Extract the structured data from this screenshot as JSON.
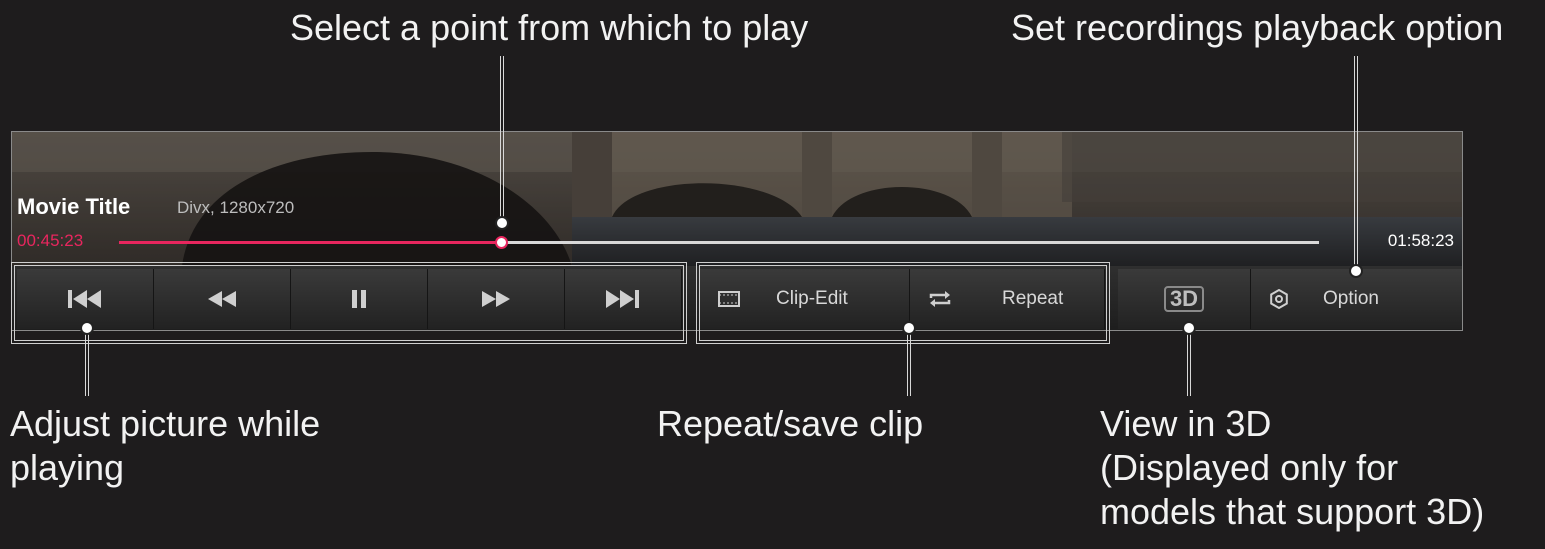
{
  "callouts": {
    "seek": "Select a point from which to play",
    "option": "Set recordings playback option",
    "adjust_line1": "Adjust picture while",
    "adjust_line2": "playing",
    "repeat_save": "Repeat/save clip",
    "view3d_line1": "View in 3D",
    "view3d_line2": "(Displayed only for",
    "view3d_line3": "models that support 3D)"
  },
  "player": {
    "title": "Movie Title",
    "meta": "Divx, 1280x720",
    "current_time": "00:45:23",
    "total_time": "01:58:23",
    "progress": 0.3182
  },
  "controls": {
    "clip_edit_label": "Clip-Edit",
    "repeat_label": "Repeat",
    "option_label": "Option",
    "three_d_label": "3D"
  },
  "icons": {
    "skip_previous": "skip-previous-icon",
    "rewind": "rewind-icon",
    "pause": "pause-icon",
    "fast_forward": "fast-forward-icon",
    "skip_next": "skip-next-icon",
    "clip_edit": "film-strip-icon",
    "repeat": "repeat-icon",
    "three_d": "3d-icon",
    "option": "gear-icon"
  },
  "colors": {
    "accent": "#e8265e",
    "background": "#1e1c1d",
    "text": "#f2f2f2"
  }
}
